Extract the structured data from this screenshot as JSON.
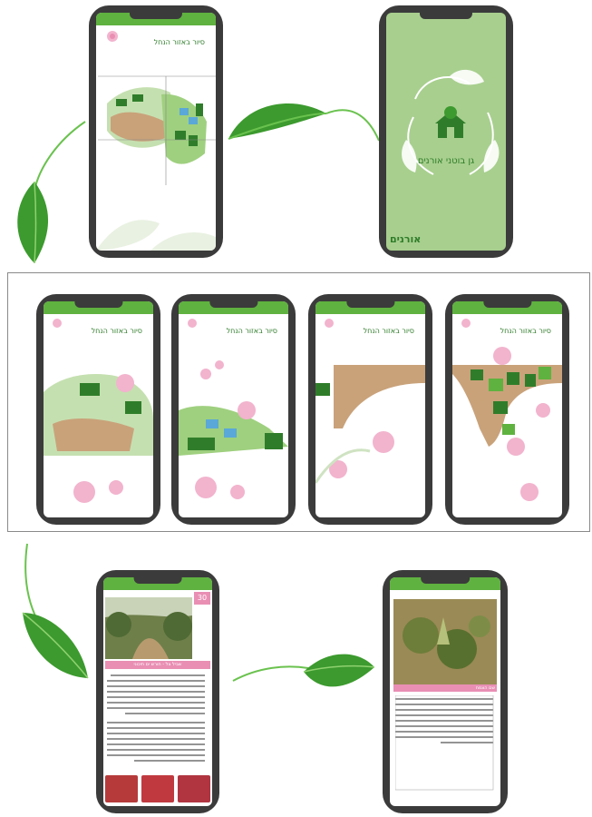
{
  "splash": {
    "app_name": "גן בוטני אורנים",
    "org_logo": "אורנים",
    "background": "#a8cf8e",
    "accent": "#2f7d2a"
  },
  "map_screen": {
    "title": "סיור באזור הנחל"
  },
  "map_tiles": [
    {
      "title": "סיור באזור הנחל"
    },
    {
      "title": "סיור באזור הנחל"
    },
    {
      "title": "סיור באזור הנחל"
    },
    {
      "title": "סיור באזור הנחל"
    }
  ],
  "detail_screen": {
    "badge": "30",
    "caption": "שביל צל - חורש ים תיכוני",
    "body_lines": 14,
    "gallery_count": 3
  },
  "plant_screen": {
    "caption": "שם הצמח"
  },
  "colors": {
    "green_bar": "#5fb23f",
    "leaf": "#3c9a2e",
    "phone_body": "#3b3b3b",
    "rose": "#e98fb4"
  },
  "icons": [
    "leaf-arrow-icon",
    "rose-icon",
    "botanic-garden-logo-icon"
  ]
}
